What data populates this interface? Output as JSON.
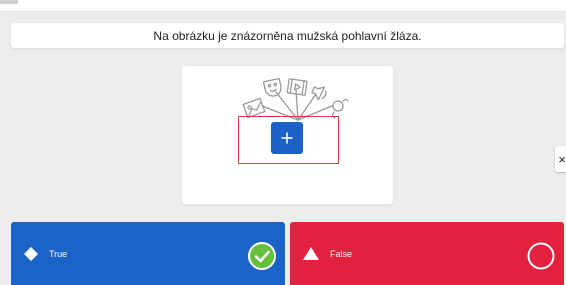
{
  "question": {
    "text": "Na obrázku je znázorněna mužská pohlavní žláza."
  },
  "media": {
    "illustration_icon": "media-placeholder-icons",
    "add_button_icon": "plus-icon"
  },
  "navigation": {
    "next_icon": "close-x-icon",
    "next_glyph": "×"
  },
  "answers": [
    {
      "label": "True",
      "shape": "diamond-icon",
      "color": "#1b63c7",
      "selected": true,
      "check_icon": "check-circle-icon"
    },
    {
      "label": "False",
      "shape": "triangle-icon",
      "color": "#e2213e",
      "selected": false,
      "check_icon": "empty-circle-icon"
    }
  ],
  "colors": {
    "background": "#ececec",
    "accent_blue": "#1c61c7",
    "highlight_red": "#d83a3a",
    "correct_green": "#66bf3c"
  }
}
